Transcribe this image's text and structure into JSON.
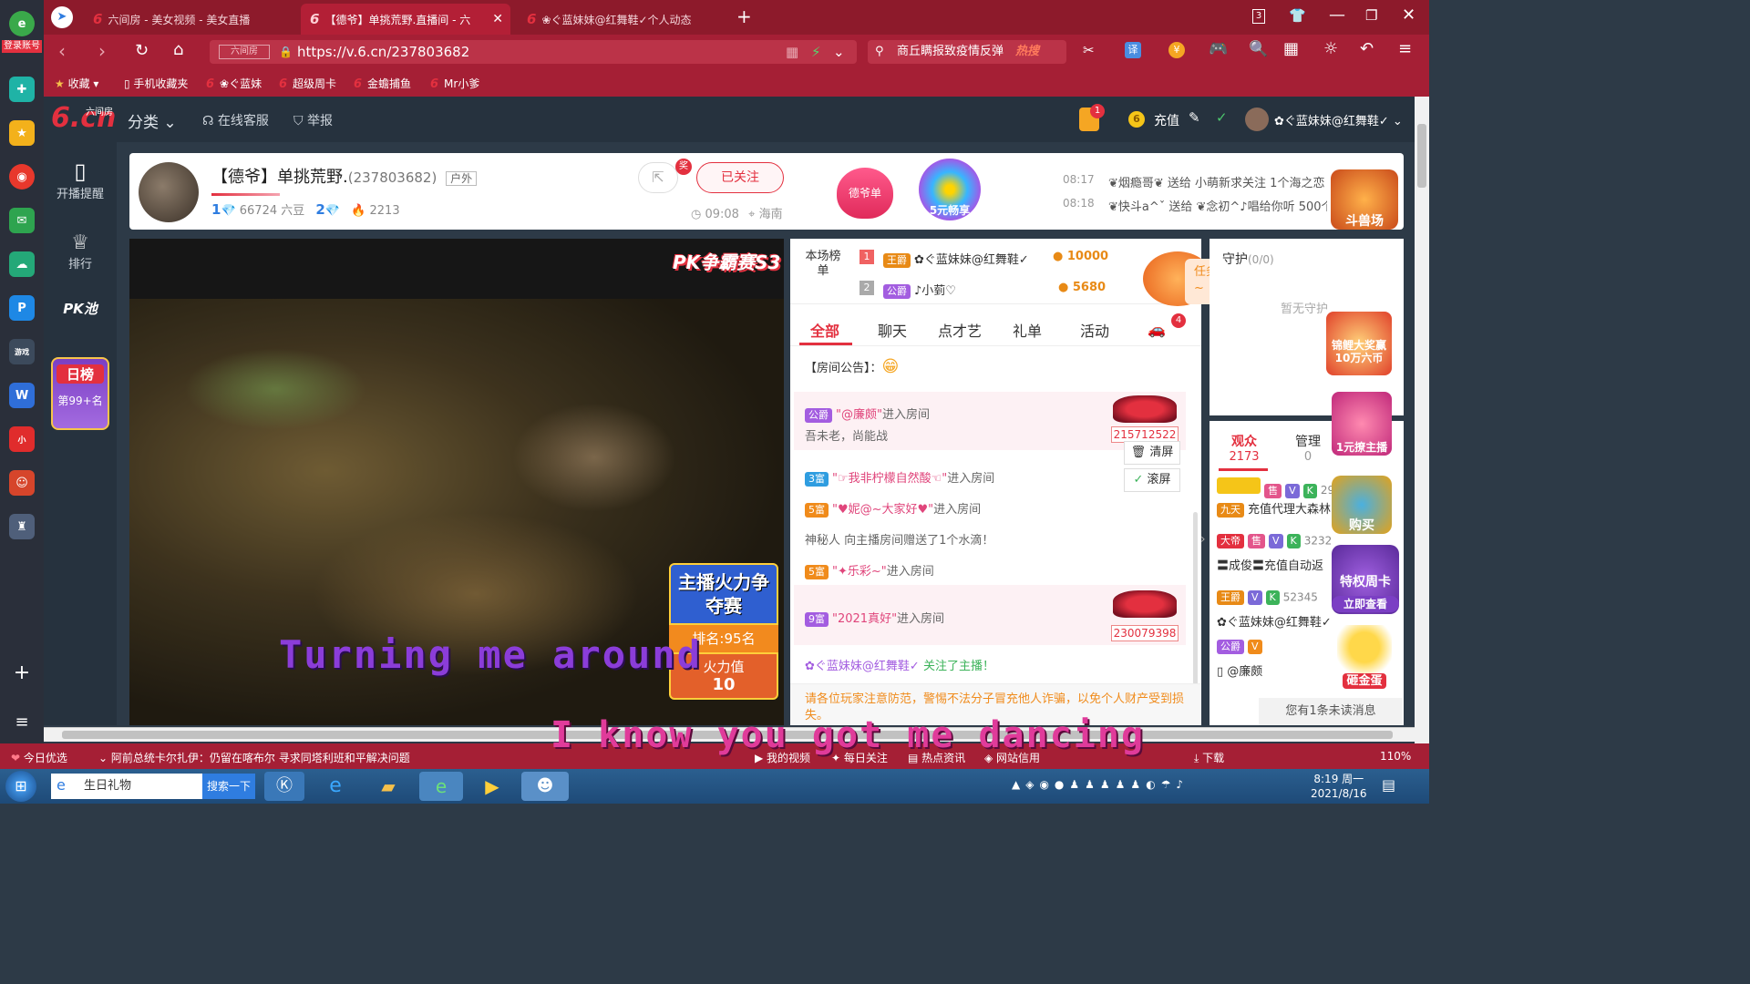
{
  "browser": {
    "login_label": "登录账号",
    "tabs": [
      {
        "label": "六间房 - 美女视频 - 美女直播"
      },
      {
        "label": "【德爷】单挑荒野.直播间 - 六"
      },
      {
        "label": "❀ぐ蓝妹妹@红舞鞋✓个人动态"
      }
    ],
    "tab_count": "3",
    "address": "https://v.6.cn/237803682",
    "address_site_tag": "六间房",
    "search_text": "商丘瞒报致疫情反弹",
    "search_hot": "热搜",
    "bookmarks": [
      "收藏",
      "手机收藏夹",
      "❀ぐ蓝妹",
      "超级周卡",
      "金蟾捕鱼",
      "Mr小爹"
    ]
  },
  "site": {
    "logo_main": "6.cn",
    "logo_sub": "六间房",
    "category": "分类",
    "service": "在线客服",
    "report": "举报",
    "notif_count": "1",
    "recharge": "充值",
    "username": "✿ぐ蓝妹妹@红舞鞋✓",
    "left_nav": [
      "开播提醒",
      "排行",
      "PK池"
    ],
    "daily_rank_title": "日榜",
    "daily_rank_value": "第99+名"
  },
  "host": {
    "name": "【德爷】单挑荒野.",
    "room_id": "(237803682)",
    "tag": "户外",
    "level1": "1",
    "beans": "66724 六豆",
    "level2": "2",
    "fans": "2213",
    "share_badge": "奖",
    "follow_button": "已关注",
    "time": "09:08",
    "location": "海南",
    "badge1": "德爷单",
    "badge2": "5元畅享",
    "feed": [
      {
        "time": "08:17",
        "text": "❦烟瘾哥❦ 送给 小萌新求关注 1个海之恋"
      },
      {
        "time": "08:18",
        "text": "❦快斗a^ˇ 送给 ❦念初^♪唱给你听 500个"
      }
    ],
    "corner_label": "斗兽场"
  },
  "video": {
    "pk_title": "PK争霸赛S3",
    "fire_title": "主播火力争夺赛",
    "rank": "排名:95名",
    "fire_label": "火力值",
    "fire_value": "10",
    "lyric1": "Turning me around",
    "lyric2": "I know you got me dancing"
  },
  "rank_board": {
    "title": "本场榜单",
    "rows": [
      {
        "no": "1",
        "badge": "王爵",
        "name": "✿ぐ蓝妹妹@红舞鞋✓",
        "score": "10000"
      },
      {
        "no": "2",
        "badge": "公爵",
        "name": "♪小菿♡",
        "score": "5680"
      }
    ],
    "task_popup": "任务完成，点击领取锦鲤活动幸运码~"
  },
  "chat": {
    "tabs": [
      "全部",
      "聊天",
      "点才艺",
      "礼单",
      "活动"
    ],
    "car_count": "4",
    "notice_label": "【房间公告】：",
    "clear_label": "清屏",
    "scroll_label": "滚屏",
    "messages": [
      {
        "badge": "公爵",
        "name": "\"@廉颇\"",
        "action": "进入房间",
        "car_id": "215712522",
        "sub": "吾未老，尚能战"
      },
      {
        "badge": "3富",
        "name": "\"☞我非柠檬自然酸☜\"",
        "action": "进入房间"
      },
      {
        "badge": "5富",
        "name": "\"♥妮@~大家好♥\"",
        "action": "进入房间"
      },
      {
        "text": "神秘人 向主播房间赠送了1个水滴！"
      },
      {
        "badge": "5富",
        "name": "\"✦乐彩~\"",
        "action": "进入房间"
      },
      {
        "badge": "9富",
        "name": "\"2021真好\"",
        "action": "进入房间",
        "car_id": "230079398"
      },
      {
        "follow_user": "✿ぐ蓝妹妹@红舞鞋✓",
        "follow_text": "关注了主播！"
      }
    ],
    "warning": "请各位玩家注意防范，警惕不法分子冒充他人诈骗，以免个人财产受到损失。"
  },
  "right": {
    "guard_label": "守护",
    "guard_count": "(0/0)",
    "guard_empty": "暂无守护",
    "koi_label": "锦鲤大奖赢10万六币",
    "one_yuan": "1元撩主播",
    "audience_label": "观众",
    "audience_count": "2173",
    "manage_label": "管理",
    "manage_count": "0",
    "users": [
      {
        "badge": "九天",
        "name": "充值代理大森林",
        "num": "29"
      },
      {
        "badge": "大帝",
        "name": "〓成俊〓充值自动返",
        "num": "3232"
      },
      {
        "badge": "王爵",
        "name": "✿ぐ蓝妹妹@红舞鞋✓",
        "num": "52345"
      },
      {
        "badge": "公爵",
        "name": "@廉颇",
        "num": ""
      }
    ],
    "buy_label": "购买",
    "privilege_card": "特权周卡",
    "view_now": "立即查看",
    "golden_egg": "砸金蛋",
    "unread_msg": "您有1条未读消息"
  },
  "statusbar": {
    "today": "今日优选",
    "news": "阿前总统卡尔扎伊：仍留在喀布尔 寻求同塔利班和平解决问题",
    "items": [
      "我的视频",
      "每日关注",
      "热点资讯",
      "网站信用",
      "下载"
    ],
    "zoom": "110%"
  },
  "taskbar": {
    "search_value": "生日礼物",
    "search_button": "搜索一下",
    "time": "8:19 周一",
    "date": "2021/8/16"
  },
  "colors": {
    "accent": "#a51f35",
    "pink": "#e0457b",
    "orange": "#f08b1b",
    "purple": "#7b3fc4"
  }
}
